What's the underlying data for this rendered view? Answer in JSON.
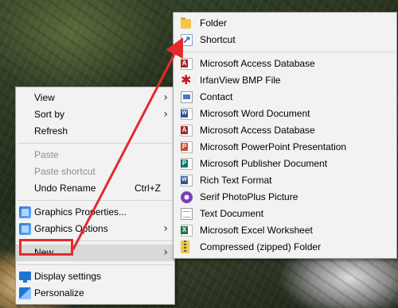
{
  "context_menu": {
    "items": [
      {
        "label": "View",
        "submenu": true
      },
      {
        "label": "Sort by",
        "submenu": true
      },
      {
        "label": "Refresh"
      },
      {
        "label": "Paste",
        "disabled": true
      },
      {
        "label": "Paste shortcut",
        "disabled": true
      },
      {
        "label": "Undo Rename",
        "shortcut": "Ctrl+Z"
      },
      {
        "label": "Graphics Properties...",
        "icon": "graphics-icon"
      },
      {
        "label": "Graphics Options",
        "icon": "graphics-icon",
        "submenu": true
      },
      {
        "label": "New",
        "submenu": true,
        "highlighted": true
      },
      {
        "label": "Display settings",
        "icon": "display-icon"
      },
      {
        "label": "Personalize",
        "icon": "personalize-icon"
      }
    ]
  },
  "new_submenu": {
    "items": [
      {
        "label": "Folder",
        "icon": "folder-icon"
      },
      {
        "label": "Shortcut",
        "icon": "shortcut-icon"
      },
      {
        "label": "Microsoft Access Database",
        "icon": "access-icon"
      },
      {
        "label": "IrfanView BMP File",
        "icon": "irfanview-icon"
      },
      {
        "label": "Contact",
        "icon": "contact-icon"
      },
      {
        "label": "Microsoft Word Document",
        "icon": "word-icon"
      },
      {
        "label": "Microsoft Access Database",
        "icon": "access-icon"
      },
      {
        "label": "Microsoft PowerPoint Presentation",
        "icon": "powerpoint-icon"
      },
      {
        "label": "Microsoft Publisher Document",
        "icon": "publisher-icon"
      },
      {
        "label": "Rich Text Format",
        "icon": "rtf-icon"
      },
      {
        "label": "Serif PhotoPlus Picture",
        "icon": "serif-icon"
      },
      {
        "label": "Text Document",
        "icon": "text-icon"
      },
      {
        "label": "Microsoft Excel Worksheet",
        "icon": "excel-icon"
      },
      {
        "label": "Compressed (zipped) Folder",
        "icon": "zip-icon"
      }
    ]
  },
  "icons": {
    "chevron": "›"
  },
  "annotation_color": "#e32b2b"
}
